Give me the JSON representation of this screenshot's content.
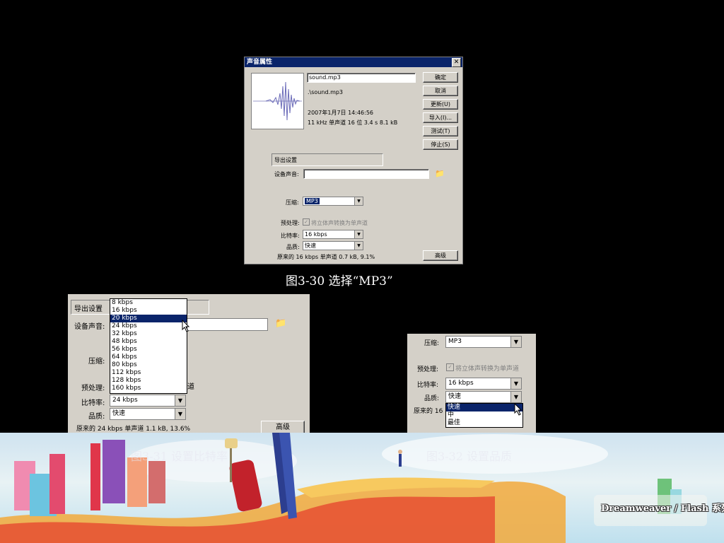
{
  "dialog": {
    "title": "声音属性",
    "close_label": "✕",
    "filename": "sound.mp3",
    "path": ".\\sound.mp3",
    "date": "2007年1月7日 14:46:56",
    "format": "11 kHz 单声道 16 位 3.4 s 8.1 kB",
    "buttons": [
      "确定",
      "取消",
      "更新(U)",
      "导入(I)...",
      "测试(T)",
      "停止(S)"
    ],
    "advanced_label": "高级",
    "export_settings": "导出设置",
    "device_sound_label": "设备声音:",
    "device_sound_value": "",
    "compression_label": "压缩:",
    "compression_value": "MP3",
    "preprocess_label": "预处理:",
    "preprocess_text": "将立体声转换为单声道",
    "preprocess_checked": true,
    "bitrate_label": "比特率:",
    "bitrate_value": "16 kbps",
    "quality_label": "品质:",
    "quality_value": "快速",
    "summary": "原来的 16 kbps 单声道 0.7 kB, 9.1%"
  },
  "caption1": "图3-30 选择“MP3”",
  "panel2": {
    "export_settings": "导出设置",
    "device_sound_label": "设备声音:",
    "compression_label": "压缩:",
    "preprocess_label": "预处理:",
    "preprocess_tail": "道",
    "bitrate_label": "比特率:",
    "bitrate_value": "24 kbps",
    "quality_label": "品质:",
    "quality_value": "快速",
    "summary": "原来的 24 kbps  单声道 1.1 kB, 13.6%",
    "advanced_label": "高级",
    "bitrate_options": [
      "8 kbps",
      "16 kbps",
      "20 kbps",
      "24 kbps",
      "32 kbps",
      "48 kbps",
      "56 kbps",
      "64 kbps",
      "80 kbps",
      "112 kbps",
      "128 kbps",
      "160 kbps"
    ],
    "selected_option": "20 kbps"
  },
  "panel3": {
    "compression_label": "压缩:",
    "compression_value": "MP3",
    "preprocess_label": "预处理:",
    "preprocess_text": "将立体声转换为单声道",
    "bitrate_label": "比特率:",
    "bitrate_value": "16 kbps",
    "quality_label": "品质:",
    "quality_value": "快速",
    "summary_prefix": "原来的 16",
    "quality_options": [
      "快速",
      "中",
      "最佳"
    ],
    "selected_option": "快速"
  },
  "caption2": "图3-31 设置比特率",
  "caption3": "图3-32 设置品质",
  "logo_text": "Dreamweaver / Flash 系列",
  "colors": {
    "titlebar": "#0a246a",
    "dialog_bg": "#d4d0c8",
    "selection": "#0a246a"
  }
}
